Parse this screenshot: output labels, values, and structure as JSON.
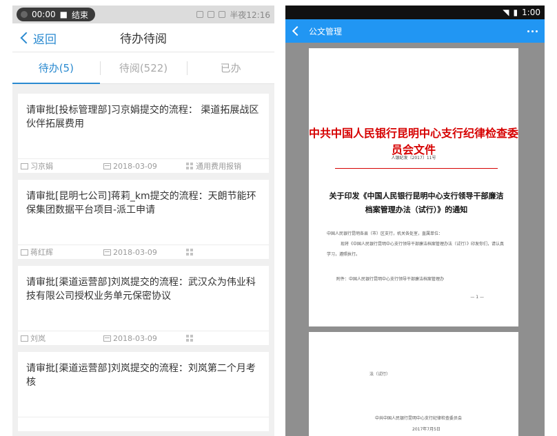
{
  "left": {
    "status_bar": {
      "time": "00:00",
      "action": "结束",
      "right_text": "半夜12:16"
    },
    "nav": {
      "back_label": "返回",
      "title": "待办待阅"
    },
    "tabs": [
      {
        "label": "待办(5)"
      },
      {
        "label": "待阅(522)"
      },
      {
        "label": "已办"
      }
    ],
    "items": [
      {
        "text": "请审批[投标管理部]习京娟提交的流程： 渠道拓展战区伙伴拓展费用",
        "person": "习京娟",
        "date": "2018-03-09",
        "category": "通用费用报销"
      },
      {
        "text": "请审批[昆明七公司]蒋莉_km提交的流程：天朗节能环保集团数据平台项目-派工申请",
        "person": "蒋红辉",
        "date": "2018-03-09",
        "category": ""
      },
      {
        "text": "请审批[渠道运营部]刘岚提交的流程：武汉众为伟业科技有限公司授权业务单元保密协议",
        "person": "刘岚",
        "date": "2018-03-09",
        "category": ""
      },
      {
        "text": "请审批[渠道运营部]刘岚提交的流程：刘岚第二个月考核",
        "person": "",
        "date": "",
        "category": ""
      }
    ]
  },
  "right": {
    "status_bar": {
      "time": "1:00"
    },
    "appbar": {
      "title": "公文管理"
    },
    "doc": {
      "header": "中共中国人民银行昆明中心支行纪律检查委员会文件",
      "number": "人银纪发〔2017〕11号",
      "title": "关于印发《中国人民银行昆明中心支行领导干部廉洁档案管理办法（试行）》的通知",
      "para1": "中国人民银行昆明各县（市）区支行，机关各处室，直属单位：",
      "para2": "现将《中国人民银行昆明中心支行领导干部廉洁档案管理办法（试行）》印发你们，请认真学习，遵照执行。",
      "attachment": "附件：中国人民银行昆明中心支行领导干部廉洁档案管理办",
      "page_no": "— 1 —",
      "p2_line1": "法（试行）",
      "p2_sign": "中共中国人民银行昆明中心支行纪律检查委员会",
      "p2_date": "2017年7月5日"
    }
  }
}
